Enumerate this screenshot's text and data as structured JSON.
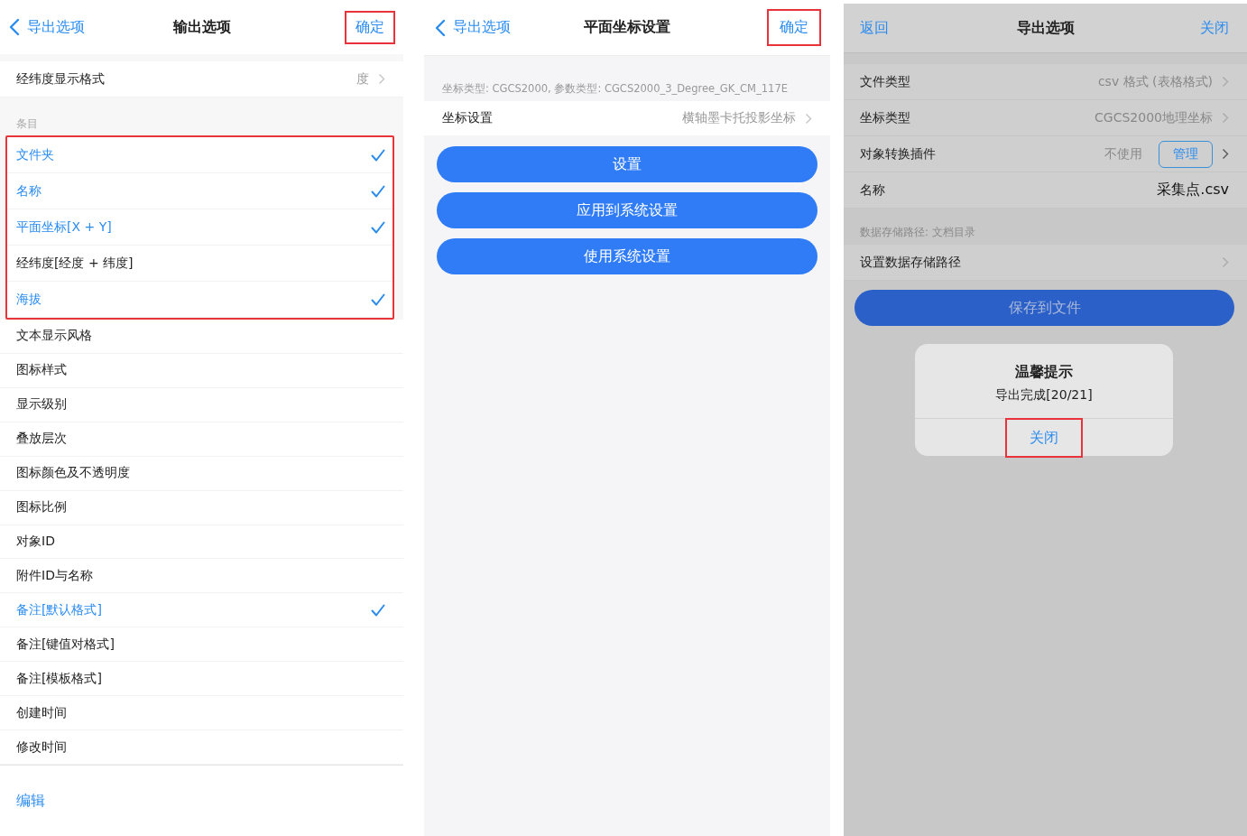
{
  "options_panel": {
    "nav": {
      "back": "导出选项",
      "title": "输出选项",
      "confirm": "确定",
      "confirm_highlighted": true
    },
    "format_row": {
      "label": "经纬度显示格式",
      "value": "度"
    },
    "section_header": "条目",
    "items": [
      {
        "label": "文件夹",
        "checked": true,
        "highlighted": true
      },
      {
        "label": "名称",
        "checked": true,
        "highlighted": true
      },
      {
        "label": "平面坐标[X + Y]",
        "checked": true,
        "highlighted": true
      },
      {
        "label": "经纬度[经度 + 纬度]",
        "checked": false,
        "highlighted": true
      },
      {
        "label": "海拔",
        "checked": true,
        "highlighted": true
      },
      {
        "label": "文本显示风格",
        "checked": false,
        "highlighted": false
      },
      {
        "label": "图标样式",
        "checked": false,
        "highlighted": false
      },
      {
        "label": "显示级别",
        "checked": false,
        "highlighted": false
      },
      {
        "label": "叠放层次",
        "checked": false,
        "highlighted": false
      },
      {
        "label": "图标颜色及不透明度",
        "checked": false,
        "highlighted": false
      },
      {
        "label": "图标比例",
        "checked": false,
        "highlighted": false
      },
      {
        "label": "对象ID",
        "checked": false,
        "highlighted": false
      },
      {
        "label": "附件ID与名称",
        "checked": false,
        "highlighted": false
      },
      {
        "label": "备注[默认格式]",
        "checked": true,
        "highlighted": false
      },
      {
        "label": "备注[键值对格式]",
        "checked": false,
        "highlighted": false
      },
      {
        "label": "备注[模板格式]",
        "checked": false,
        "highlighted": false
      },
      {
        "label": "创建时间",
        "checked": false,
        "highlighted": false
      },
      {
        "label": "修改时间",
        "checked": false,
        "highlighted": false
      }
    ],
    "edit": "编辑"
  },
  "coordinate_panel": {
    "nav": {
      "back": "导出选项",
      "title": "平面坐标设置",
      "confirm": "确定",
      "confirm_highlighted": true
    },
    "info": "坐标类型: CGCS2000, 参数类型: CGCS2000_3_Degree_GK_CM_117E",
    "setting_row": {
      "label": "坐标设置",
      "value": "横轴墨卡托投影坐标"
    },
    "buttons": [
      "设置",
      "应用到系统设置",
      "使用系统设置"
    ]
  },
  "export_panel": {
    "nav": {
      "back": "返回",
      "title": "导出选项",
      "close": "关闭"
    },
    "rows": [
      {
        "kind": "value",
        "label": "文件类型",
        "value": "csv 格式 (表格格式)"
      },
      {
        "kind": "value",
        "label": "坐标类型",
        "value": "CGCS2000地理坐标"
      },
      {
        "kind": "plugin",
        "label": "对象转换插件",
        "value": "不使用",
        "button": "管理"
      },
      {
        "kind": "name",
        "label": "名称",
        "value": "采集点.csv"
      }
    ],
    "path_note": "数据存储路径: 文档目录",
    "path_row": "设置数据存储路径",
    "save_button": "保存到文件",
    "dialog": {
      "title": "温馨提示",
      "message": "导出完成[20/21]",
      "button": "关闭",
      "button_highlighted": true
    }
  }
}
